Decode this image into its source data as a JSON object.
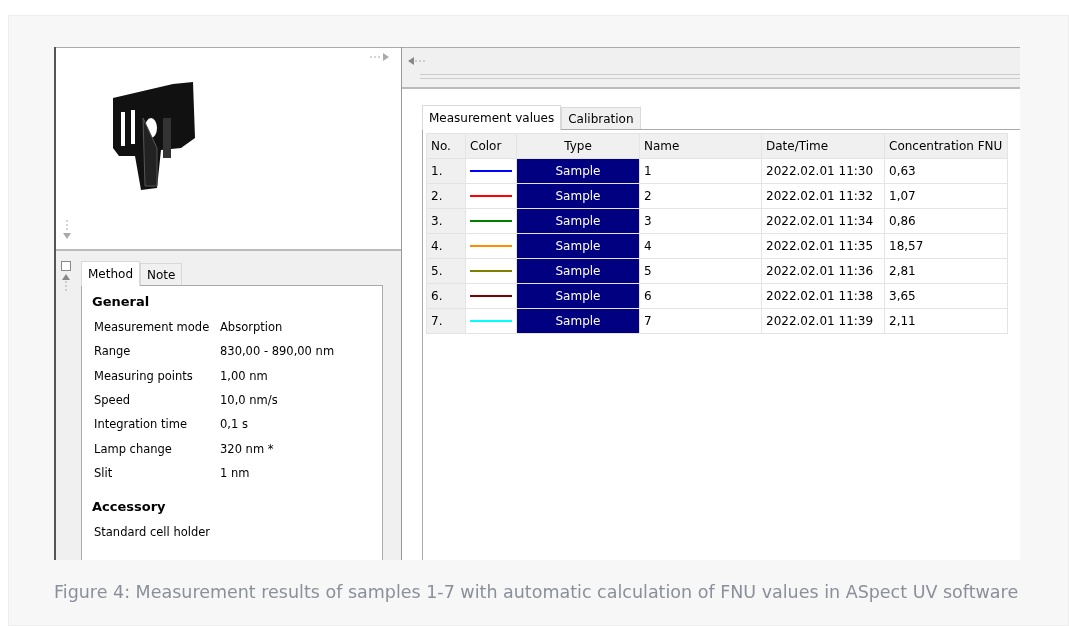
{
  "left_panel": {
    "tabs": [
      {
        "label": "Method",
        "selected": true
      },
      {
        "label": "Note",
        "selected": false
      }
    ],
    "sections": [
      {
        "heading": "General",
        "rows": [
          {
            "label": "Measurement mode",
            "value": "Absorption"
          },
          {
            "label": "Range",
            "value": "830,00 - 890,00 nm"
          },
          {
            "label": "Measuring points",
            "value": "1,00 nm"
          },
          {
            "label": "Speed",
            "value": "10,0 nm/s"
          },
          {
            "label": "Integration time",
            "value": "0,1 s"
          },
          {
            "label": "Lamp change",
            "value": "320 nm *"
          },
          {
            "label": "Slit",
            "value": "1 nm"
          }
        ]
      },
      {
        "heading": "Accessory",
        "rows": [
          {
            "label": "Standard cell holder"
          }
        ]
      }
    ]
  },
  "right_panel": {
    "tabs": [
      {
        "label": "Measurement values",
        "selected": true
      },
      {
        "label": "Calibration",
        "selected": false
      }
    ],
    "table": {
      "columns": [
        "No.",
        "Color",
        "Type",
        "Name",
        "Date/Time",
        "Concentration FNU"
      ],
      "rows": [
        {
          "no": "1.",
          "color": "#0000ff",
          "type": "Sample",
          "name": "1",
          "datetime": "2022.02.01 11:30",
          "concentration": "0,63"
        },
        {
          "no": "2.",
          "color": "#ff0000",
          "type": "Sample",
          "name": "2",
          "datetime": "2022.02.01 11:32",
          "concentration": "1,07"
        },
        {
          "no": "3.",
          "color": "#008000",
          "type": "Sample",
          "name": "3",
          "datetime": "2022.02.01 11:34",
          "concentration": "0,86"
        },
        {
          "no": "4.",
          "color": "#ff8c00",
          "type": "Sample",
          "name": "4",
          "datetime": "2022.02.01 11:35",
          "concentration": "18,57"
        },
        {
          "no": "5.",
          "color": "#808000",
          "type": "Sample",
          "name": "5",
          "datetime": "2022.02.01 11:36",
          "concentration": "2,81"
        },
        {
          "no": "6.",
          "color": "#800000",
          "type": "Sample",
          "name": "6",
          "datetime": "2022.02.01 11:38",
          "concentration": "3,65"
        },
        {
          "no": "7.",
          "color": "#00ffff",
          "type": "Sample",
          "name": "7",
          "datetime": "2022.02.01 11:39",
          "concentration": "2,11"
        }
      ]
    }
  },
  "caption": "Figure 4: Measurement results of samples 1-7 with automatic calculation of FNU values in ASpect UV software"
}
